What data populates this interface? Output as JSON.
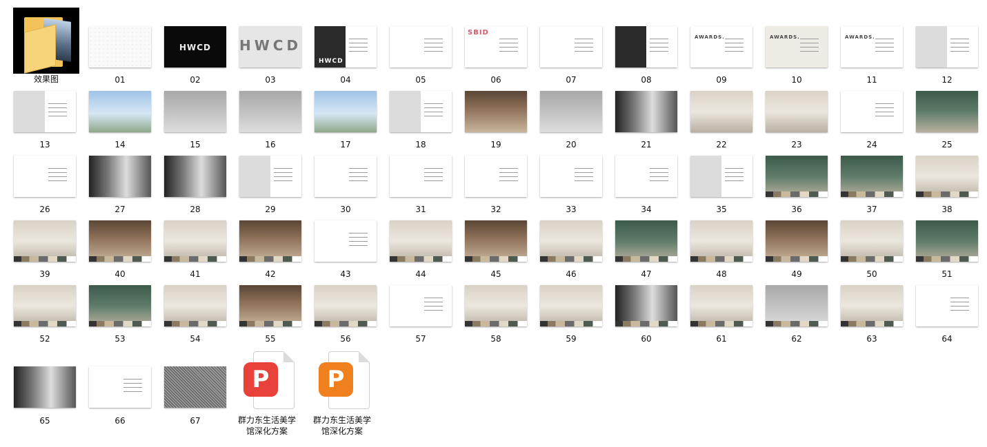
{
  "folder": {
    "label": "效果图",
    "icon": "folder-icon"
  },
  "files": [
    {
      "label": "01",
      "style": "dots"
    },
    {
      "label": "02",
      "style": "black",
      "word": "HWCD"
    },
    {
      "label": "03",
      "style": "gray",
      "word": "HWCD"
    },
    {
      "label": "04",
      "style": "darkhalf",
      "word": "HWCD"
    },
    {
      "label": "05",
      "style": "white"
    },
    {
      "label": "06",
      "style": "white",
      "word": "SBID"
    },
    {
      "label": "07",
      "style": "white"
    },
    {
      "label": "08",
      "style": "darkhalf"
    },
    {
      "label": "09",
      "style": "white",
      "word": "AWARDS."
    },
    {
      "label": "10",
      "style": "beige",
      "word": "AWARDS."
    },
    {
      "label": "11",
      "style": "white",
      "word": "AWARDS."
    },
    {
      "label": "12",
      "style": "grayhalf"
    },
    {
      "label": "13",
      "style": "grayhalf"
    },
    {
      "label": "14",
      "style": "photo-sky"
    },
    {
      "label": "15",
      "style": "photo-gray"
    },
    {
      "label": "16",
      "style": "photo-gray"
    },
    {
      "label": "17",
      "style": "photo-sky"
    },
    {
      "label": "18",
      "style": "grayhalf"
    },
    {
      "label": "19",
      "style": "photo-brown"
    },
    {
      "label": "20",
      "style": "photo-gray"
    },
    {
      "label": "21",
      "style": "photo-mono"
    },
    {
      "label": "22",
      "style": "photo-beige"
    },
    {
      "label": "23",
      "style": "photo-beige"
    },
    {
      "label": "24",
      "style": "white"
    },
    {
      "label": "25",
      "style": "photo-green"
    },
    {
      "label": "26",
      "style": "white"
    },
    {
      "label": "27",
      "style": "photo-mono"
    },
    {
      "label": "28",
      "style": "photo-mono"
    },
    {
      "label": "29",
      "style": "grayhalf"
    },
    {
      "label": "30",
      "style": "white"
    },
    {
      "label": "31",
      "style": "white"
    },
    {
      "label": "32",
      "style": "white"
    },
    {
      "label": "33",
      "style": "white"
    },
    {
      "label": "34",
      "style": "white"
    },
    {
      "label": "35",
      "style": "grayhalf"
    },
    {
      "label": "36",
      "style": "photo-green"
    },
    {
      "label": "37",
      "style": "photo-green"
    },
    {
      "label": "38",
      "style": "photo-beige"
    },
    {
      "label": "39",
      "style": "photo-beige"
    },
    {
      "label": "40",
      "style": "photo-brown"
    },
    {
      "label": "41",
      "style": "photo-beige"
    },
    {
      "label": "42",
      "style": "photo-brown"
    },
    {
      "label": "43",
      "style": "white"
    },
    {
      "label": "44",
      "style": "photo-beige"
    },
    {
      "label": "45",
      "style": "photo-brown"
    },
    {
      "label": "46",
      "style": "photo-beige"
    },
    {
      "label": "47",
      "style": "photo-green"
    },
    {
      "label": "48",
      "style": "photo-beige"
    },
    {
      "label": "49",
      "style": "photo-brown"
    },
    {
      "label": "50",
      "style": "photo-beige"
    },
    {
      "label": "51",
      "style": "photo-green"
    },
    {
      "label": "52",
      "style": "photo-beige"
    },
    {
      "label": "53",
      "style": "photo-green"
    },
    {
      "label": "54",
      "style": "photo-beige"
    },
    {
      "label": "55",
      "style": "photo-brown"
    },
    {
      "label": "56",
      "style": "photo-beige"
    },
    {
      "label": "57",
      "style": "white"
    },
    {
      "label": "58",
      "style": "photo-beige"
    },
    {
      "label": "59",
      "style": "photo-beige"
    },
    {
      "label": "60",
      "style": "photo-mono"
    },
    {
      "label": "61",
      "style": "photo-beige"
    },
    {
      "label": "62",
      "style": "photo-gray"
    },
    {
      "label": "63",
      "style": "photo-beige"
    },
    {
      "label": "64",
      "style": "white"
    },
    {
      "label": "65",
      "style": "photo-mono"
    },
    {
      "label": "66",
      "style": "white"
    },
    {
      "label": "67",
      "style": "stripes"
    }
  ],
  "documents": [
    {
      "label": "群力东生活美学馆深化方案",
      "line1": "群力东生活美学",
      "line2": "馆深化方案",
      "icon": "wps-pdf-icon",
      "badge_color": "#e8413a"
    },
    {
      "label": "群力东生活美学馆深化方案",
      "line1": "群力东生活美学",
      "line2": "馆深化方案",
      "icon": "wps-presentation-icon",
      "badge_color": "#f07f1e"
    }
  ]
}
